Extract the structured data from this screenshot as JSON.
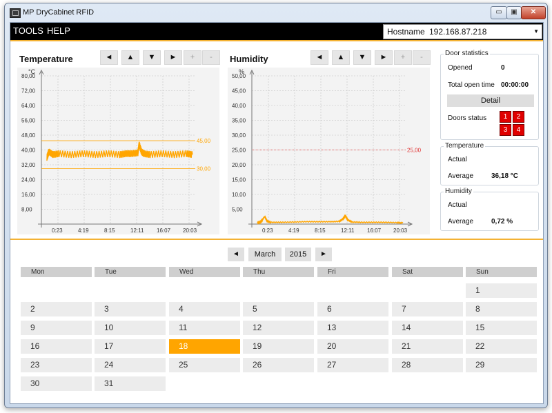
{
  "window": {
    "title": "MP DryCabinet RFID"
  },
  "menu": {
    "items": [
      "TOOLS",
      "HELP"
    ]
  },
  "host": {
    "label": "Hostname",
    "value": "192.168.87.218"
  },
  "temperature_panel": {
    "title": "Temperature",
    "unit": "°C",
    "buttons": [
      "◄",
      "▲",
      "▼",
      "►",
      "+",
      "-"
    ]
  },
  "humidity_panel": {
    "title": "Humidity",
    "unit": "%",
    "buttons": [
      "◄",
      "▲",
      "▼",
      "►",
      "+",
      "-"
    ]
  },
  "chart_data": [
    {
      "type": "line",
      "title": "Temperature",
      "ylabel": "°C",
      "ylim": [
        0,
        80
      ],
      "y_ticks": [
        "80,00",
        "72,00",
        "64,00",
        "56,00",
        "48,00",
        "40,00",
        "32,00",
        "24,00",
        "16,00",
        "8,00"
      ],
      "x_ticks": [
        "0:23",
        "4:19",
        "8:15",
        "12:11",
        "16:07",
        "20:03"
      ],
      "upper_limit": {
        "value": 45,
        "label": "45,00"
      },
      "lower_limit": {
        "value": 30,
        "label": "30,00"
      },
      "series": [
        {
          "x": [
            0.0,
            0.33,
            1.0,
            2.0,
            4.0,
            6.0,
            8.0,
            10.0,
            12.0,
            13.0,
            14.0,
            15.0,
            15.2,
            15.6,
            16.0,
            17.0,
            19.0,
            21.0,
            23.0,
            24.0
          ],
          "y": [
            36,
            39,
            37.5,
            38,
            37.5,
            38,
            37.5,
            38,
            37.5,
            38,
            38,
            38.5,
            43,
            39,
            38,
            37.5,
            38,
            37.5,
            38,
            37.5
          ]
        }
      ],
      "grid": true
    },
    {
      "type": "line",
      "title": "Humidity",
      "ylabel": "%",
      "ylim": [
        0,
        50
      ],
      "y_ticks": [
        "50,00",
        "45,00",
        "40,00",
        "35,00",
        "30,00",
        "25,00",
        "20,00",
        "15,00",
        "10,00",
        "5,00"
      ],
      "x_ticks": [
        "0:23",
        "4:19",
        "8:15",
        "12:11",
        "16:07",
        "20:03"
      ],
      "limit": {
        "value": 25,
        "label": "25,00"
      },
      "series": [
        {
          "x": [
            0.0,
            0.5,
            0.9,
            1.2,
            1.6,
            2.2,
            4.0,
            6.0,
            8.0,
            10.0,
            12.0,
            13.5,
            14.1,
            14.5,
            14.9,
            15.6,
            17.0,
            19.0,
            21.0,
            23.0,
            24.0
          ],
          "y": [
            0.4,
            0.7,
            1.5,
            2.6,
            1.0,
            0.6,
            0.6,
            0.7,
            0.8,
            0.8,
            0.8,
            0.9,
            1.7,
            2.8,
            1.4,
            0.7,
            0.6,
            0.6,
            0.6,
            0.5,
            0.4
          ]
        }
      ],
      "grid": true
    }
  ],
  "door_stats": {
    "title": "Door statistics",
    "opened_label": "Opened",
    "opened_value": "0",
    "open_time_label": "Total open time",
    "open_time_value": "00:00:00",
    "detail_button": "Detail",
    "doors_label": "Doors status",
    "doors": [
      "1",
      "2",
      "3",
      "4"
    ],
    "door_color": "#e00000"
  },
  "temp_stats": {
    "title": "Temperature",
    "actual_label": "Actual",
    "actual_value": "",
    "average_label": "Average",
    "average_value": "36,18 °C"
  },
  "hum_stats": {
    "title": "Humidity",
    "actual_label": "Actual",
    "actual_value": "",
    "average_label": "Average",
    "average_value": "0,72 %"
  },
  "calendar": {
    "prev": "◄",
    "next": "►",
    "month": "March",
    "year": "2015",
    "weekdays": [
      "Mon",
      "Tue",
      "Wed",
      "Thu",
      "Fri",
      "Sat",
      "Sun"
    ],
    "first_weekday_index": 6,
    "days_in_month": 31,
    "selected_day": 18,
    "accent": "#ffa500"
  },
  "colors": {
    "series": "#ffa500",
    "limit_humidity": "#e03030",
    "accent_line": "#f4b233"
  }
}
